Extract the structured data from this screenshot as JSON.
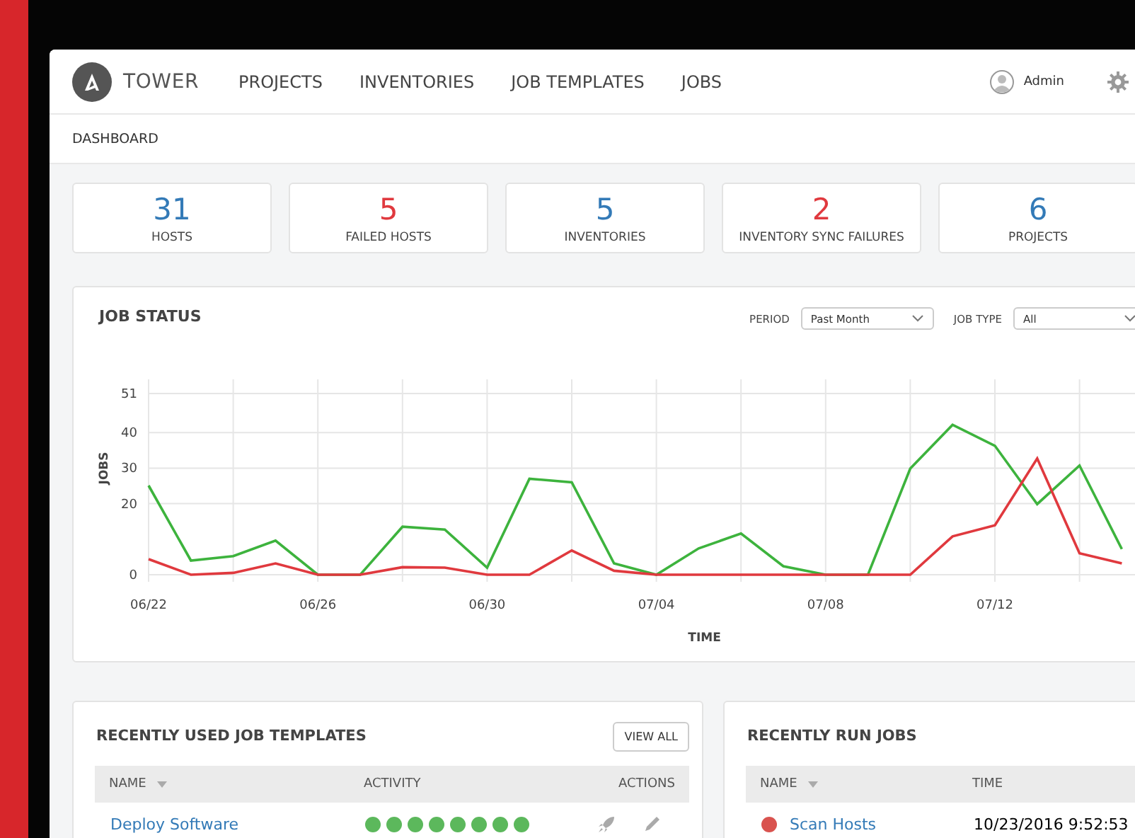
{
  "nav": {
    "brand": "TOWER",
    "items": [
      {
        "label": "PROJECTS",
        "selected": false
      },
      {
        "label": "INVENTORIES",
        "selected": false
      },
      {
        "label": "JOB TEMPLATES",
        "selected": false
      },
      {
        "label": "JOBS",
        "selected": false
      }
    ],
    "user": "Admin"
  },
  "breadcrumb": "DASHBOARD",
  "stats": [
    {
      "value": "31",
      "label": "HOSTS",
      "kind": "ok"
    },
    {
      "value": "5",
      "label": "FAILED HOSTS",
      "kind": "failed"
    },
    {
      "value": "5",
      "label": "INVENTORIES",
      "kind": "ok"
    },
    {
      "value": "2",
      "label": "INVENTORY SYNC FAILURES",
      "kind": "failed"
    },
    {
      "value": "6",
      "label": "PROJECTS",
      "kind": "ok"
    }
  ],
  "job_status": {
    "title": "JOB STATUS",
    "filters": [
      {
        "label": "PERIOD",
        "value": "Past Month"
      },
      {
        "label": "JOB TYPE",
        "value": "All"
      }
    ],
    "chart_data": {
      "type": "line",
      "xlabel": "TIME",
      "ylabel": "JOBS",
      "categories": [
        "06/22",
        null,
        null,
        null,
        "06/26",
        null,
        null,
        null,
        "06/30",
        null,
        null,
        null,
        "07/04",
        null,
        null,
        null,
        "07/08",
        null,
        null,
        null,
        "07/12",
        null,
        null,
        null
      ],
      "yticks": [
        0,
        20,
        30,
        40,
        51
      ],
      "ylim": [
        0,
        51
      ],
      "grid": true,
      "series": [
        {
          "color": "#3db33d",
          "values": [
            25.1,
            4,
            5.2,
            9.6,
            0,
            0,
            13.5,
            12.7,
            2,
            27,
            26,
            3.2,
            0,
            7.4,
            11.6,
            2.4,
            0,
            0,
            29.9,
            42.2,
            36.3,
            19.9,
            30.7,
            7.2
          ]
        },
        {
          "color": "#e0393e",
          "values": [
            4.4,
            0,
            0.5,
            3.2,
            0,
            0,
            2.1,
            2,
            0,
            0,
            6.8,
            1.1,
            0,
            0,
            0,
            0,
            0,
            0,
            0,
            10.8,
            13.9,
            32.7,
            6,
            3.2
          ]
        }
      ]
    }
  },
  "templates": {
    "title": "RECENTLY USED JOB TEMPLATES",
    "button": "VIEW ALL",
    "columns": [
      "NAME",
      "ACTIVITY",
      "ACTIONS"
    ],
    "rows": [
      {
        "name": "Deploy Software",
        "activity": [
          {
            "color": "#5cb85c"
          },
          {
            "color": "#5cb85c"
          },
          {
            "color": "#5cb85c"
          },
          {
            "color": "#5cb85c"
          },
          {
            "color": "#5cb85c"
          },
          {
            "color": "#5cb85c"
          },
          {
            "color": "#5cb85c"
          },
          {
            "color": "#5cb85c"
          }
        ]
      }
    ]
  },
  "jobs": {
    "title": "RECENTLY RUN JOBS",
    "columns": [
      "NAME",
      "TIME"
    ],
    "rows": [
      {
        "name": "Scan Hosts",
        "color": "#d9534f",
        "time": "10/23/2016 9:52:53"
      }
    ]
  }
}
